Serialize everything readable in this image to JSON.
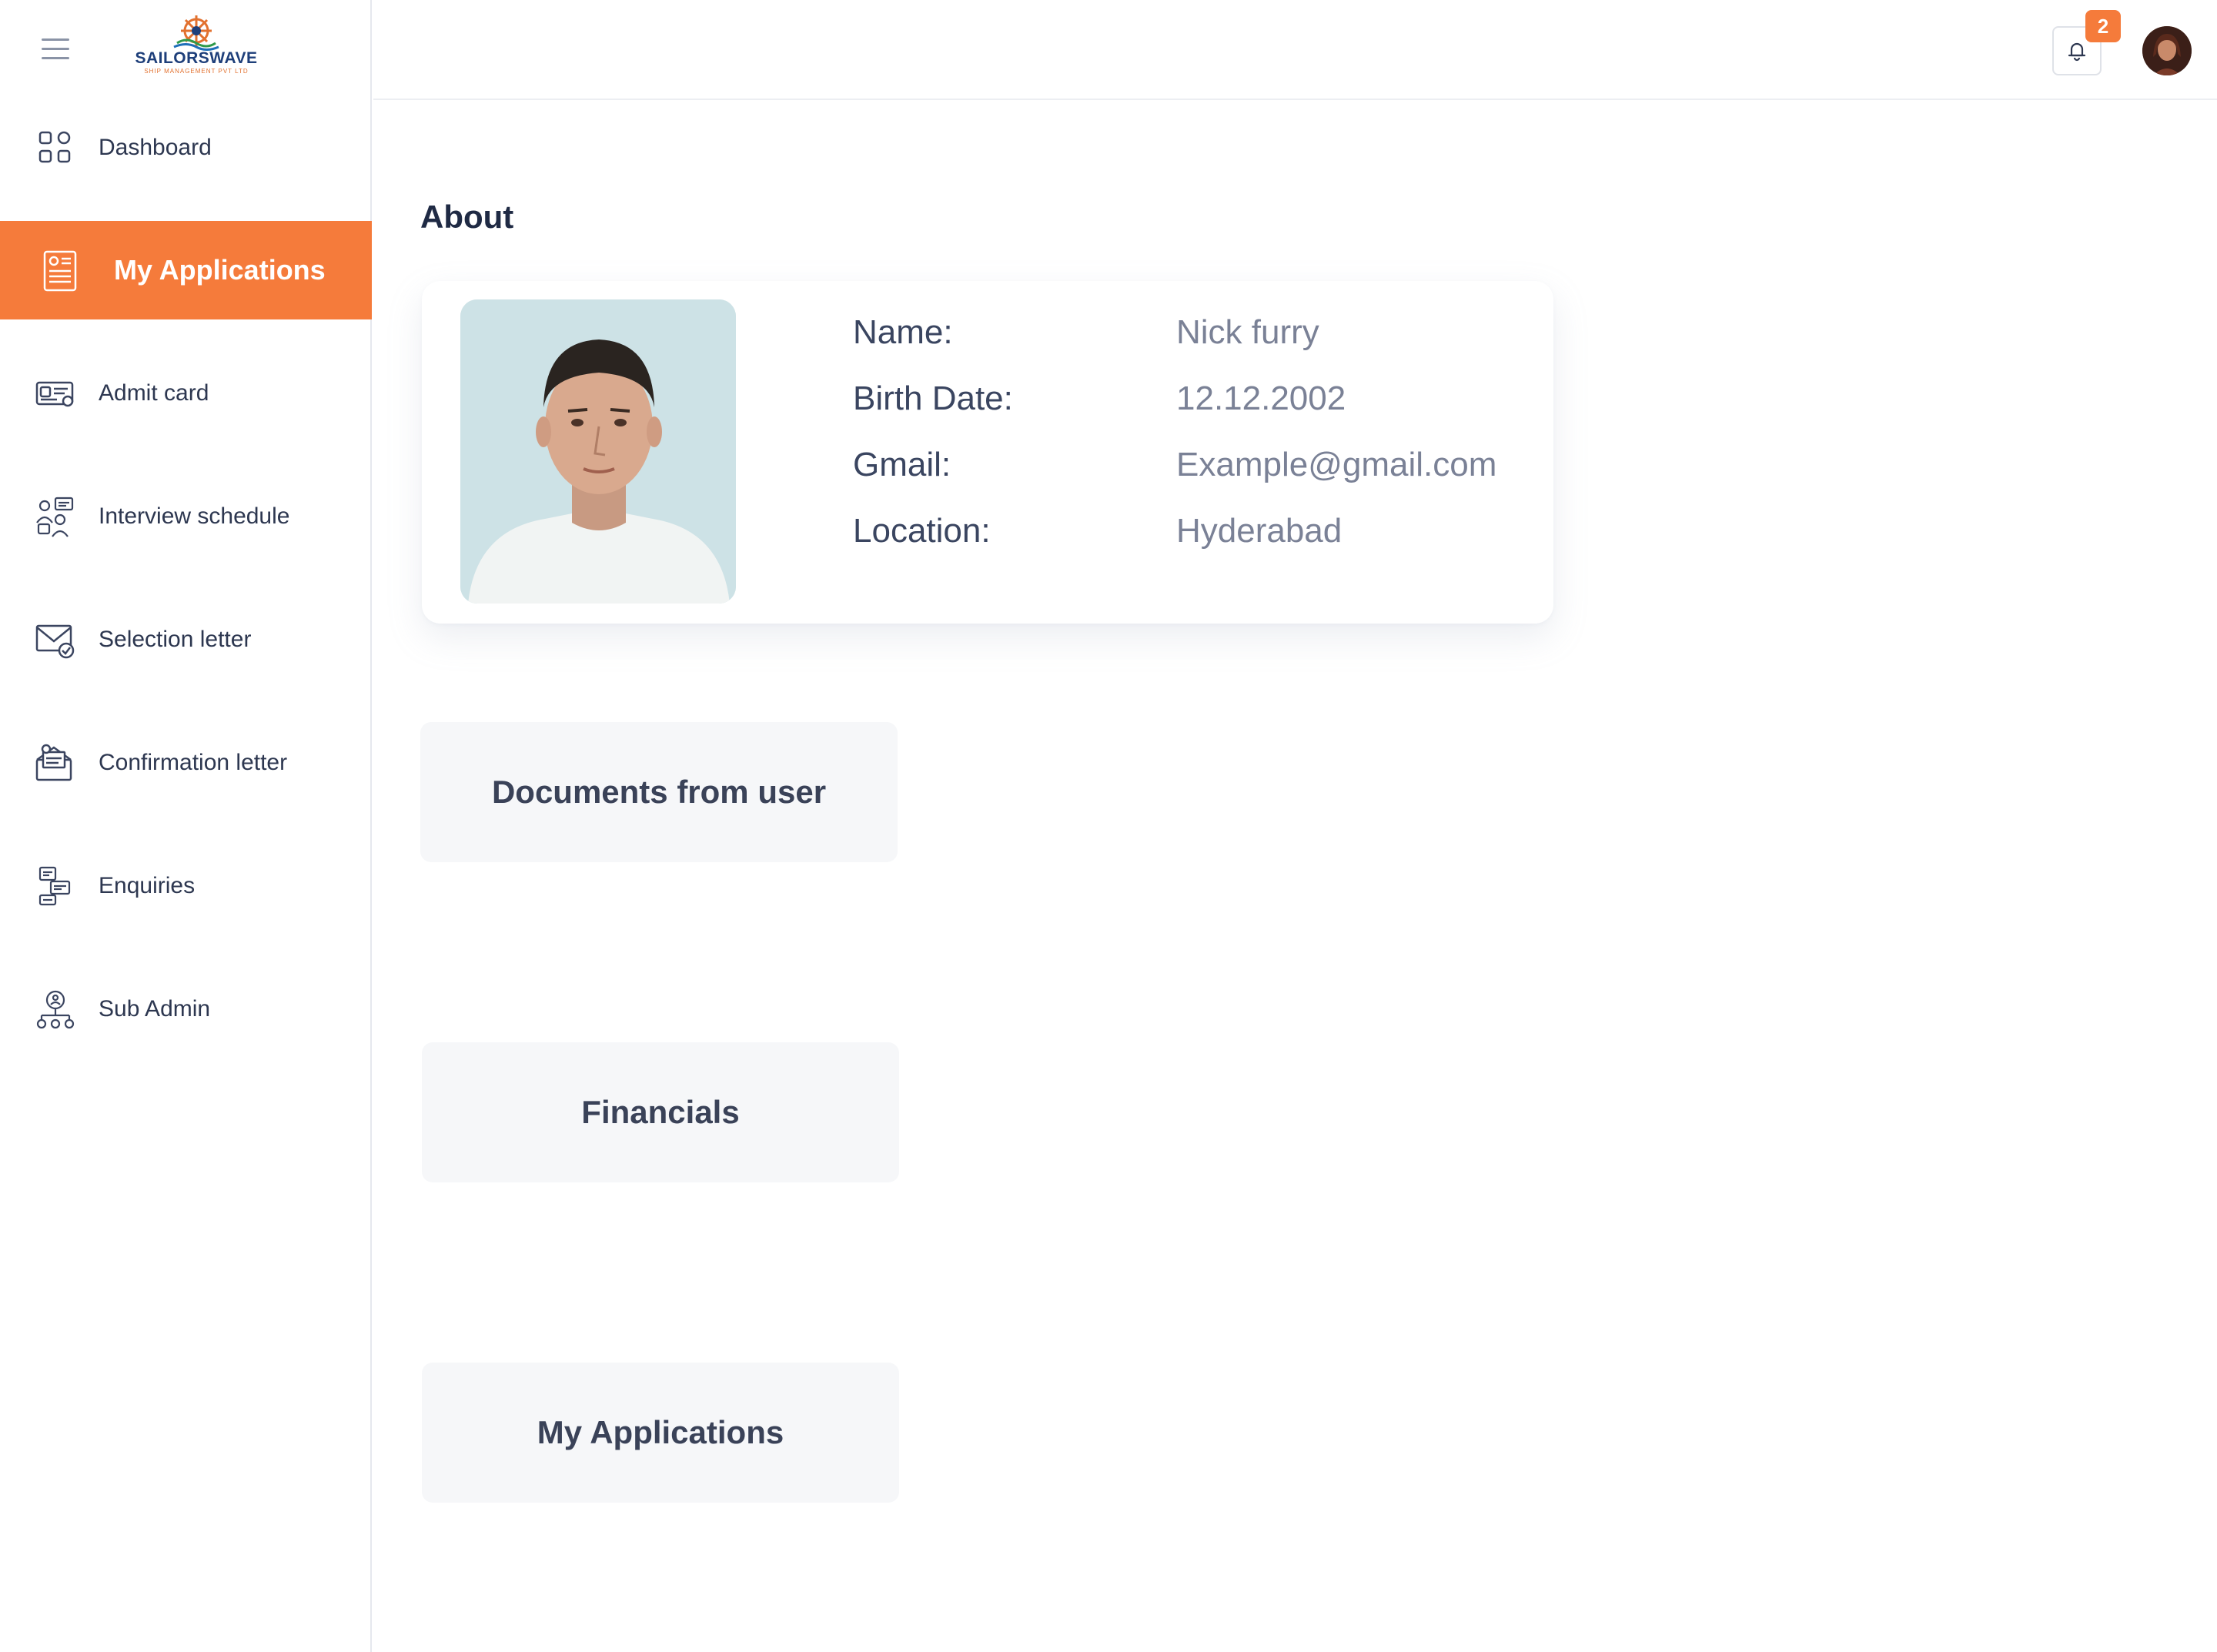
{
  "brand": {
    "name": "SAILORSWAVE",
    "tagline": "SHIP MANAGEMENT PVT LTD",
    "colors": {
      "accent": "#f57b3b",
      "navy": "#1e3f7a"
    }
  },
  "sidebar": {
    "items": [
      {
        "label": "Dashboard",
        "icon": "dashboard-grid-icon"
      },
      {
        "label": "My Applications",
        "icon": "application-form-icon",
        "active": true
      },
      {
        "label": "Admit card",
        "icon": "id-card-icon"
      },
      {
        "label": "Interview schedule",
        "icon": "interview-icon"
      },
      {
        "label": "Selection letter",
        "icon": "mail-check-icon"
      },
      {
        "label": "Confirmation letter",
        "icon": "open-letter-icon"
      },
      {
        "label": "Enquiries",
        "icon": "enquiry-chat-icon"
      },
      {
        "label": "Sub Admin",
        "icon": "org-network-icon"
      }
    ]
  },
  "header": {
    "notification_count": "2"
  },
  "about": {
    "title": "About",
    "fields": [
      {
        "label": "Name:",
        "value": "Nick furry"
      },
      {
        "label": "Birth Date:",
        "value": "12.12.2002"
      },
      {
        "label": "Gmail:",
        "value": "Example@gmail.com"
      },
      {
        "label": "Location:",
        "value": "Hyderabad"
      }
    ]
  },
  "tiles": [
    {
      "label": "Documents from user"
    },
    {
      "label": "Financials"
    },
    {
      "label": "My Applications"
    }
  ]
}
